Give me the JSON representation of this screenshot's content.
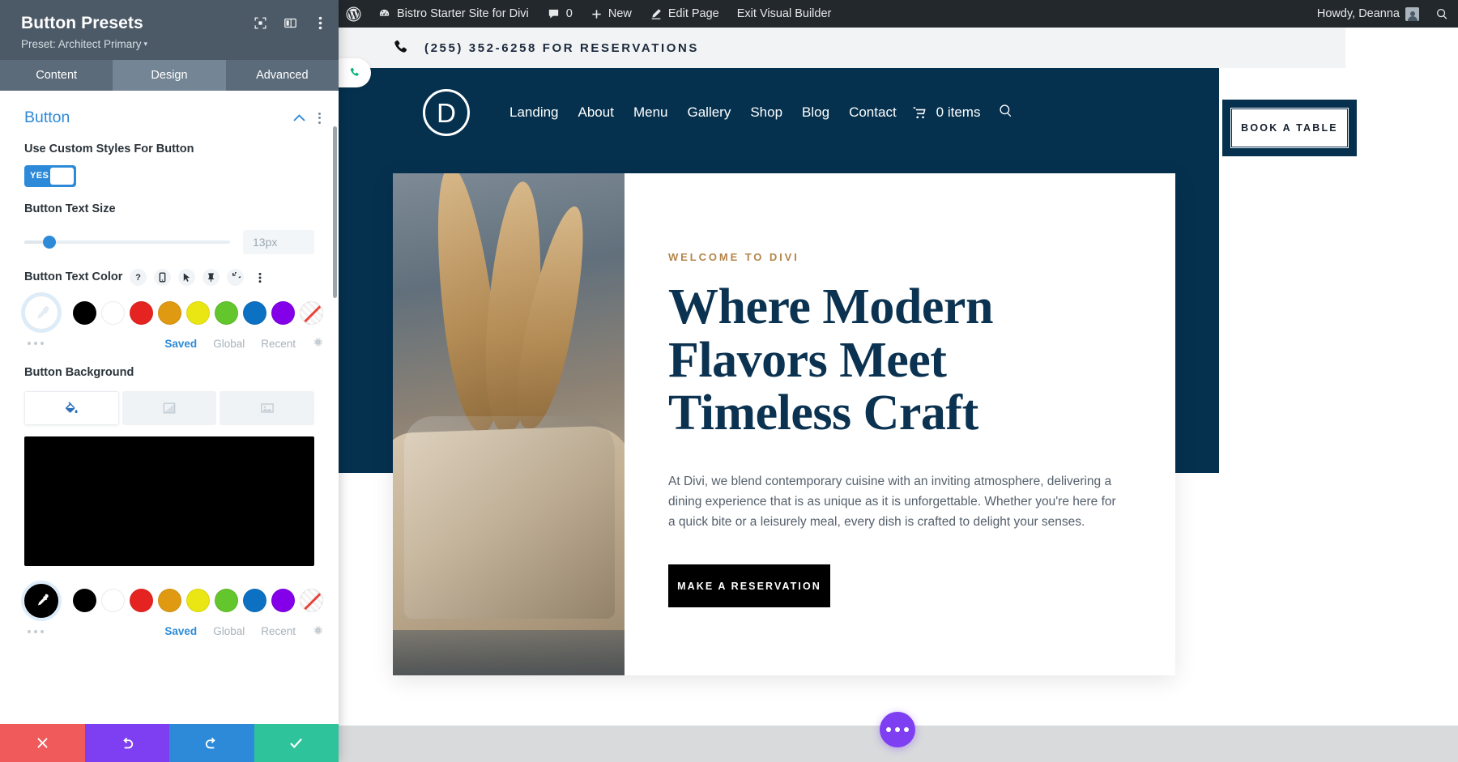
{
  "settings_panel": {
    "title": "Button Presets",
    "preset_label": "Preset: Architect Primary",
    "preset_caret": "▾",
    "header_icons": [
      "focus-target-icon",
      "layout-columns-icon",
      "more-vertical-icon"
    ],
    "tabs": [
      {
        "label": "Content",
        "active": false
      },
      {
        "label": "Design",
        "active": true
      },
      {
        "label": "Advanced",
        "active": false
      }
    ],
    "section": {
      "title": "Button",
      "collapse_icon": "chevron-up-icon",
      "more_icon": "more-vertical-icon"
    },
    "fields": {
      "custom_styles": {
        "label": "Use Custom Styles For Button",
        "toggle_value": "YES"
      },
      "text_size": {
        "label": "Button Text Size",
        "value": "13px",
        "slider_percent": 9
      },
      "text_color": {
        "label": "Button Text Color",
        "control_icons": [
          "help-icon",
          "responsive-icon",
          "hover-icon",
          "sticky-icon",
          "reset-icon",
          "more-vertical-icon"
        ],
        "swatches": [
          "#000000",
          "#ffffff",
          "#e52421",
          "#e09a12",
          "#eae614",
          "#62c62c",
          "#0c71c3",
          "#8300e9",
          "none"
        ],
        "meta_tabs": [
          {
            "label": "Saved",
            "active": true
          },
          {
            "label": "Global",
            "active": false
          },
          {
            "label": "Recent",
            "active": false
          }
        ],
        "gear_icon": "gear-icon",
        "picker_icon": "eyedropper-icon"
      },
      "background": {
        "label": "Button Background",
        "types": [
          {
            "name": "color-fill-icon",
            "active": true
          },
          {
            "name": "gradient-icon",
            "active": false
          },
          {
            "name": "image-icon",
            "active": false
          }
        ],
        "preview_color": "#000000",
        "swatches": [
          "#000000",
          "#ffffff",
          "#e52421",
          "#e09a12",
          "#eae614",
          "#62c62c",
          "#0c71c3",
          "#8300e9",
          "none"
        ],
        "meta_tabs": [
          {
            "label": "Saved",
            "active": true
          },
          {
            "label": "Global",
            "active": false
          },
          {
            "label": "Recent",
            "active": false
          }
        ],
        "gear_icon": "gear-icon",
        "picker_icon": "eyedropper-icon"
      }
    },
    "footer": [
      {
        "name": "cancel-button",
        "icon": "close-icon",
        "color": "#f15a5a"
      },
      {
        "name": "undo-button",
        "icon": "undo-icon",
        "color": "#7e3ff2"
      },
      {
        "name": "redo-button",
        "icon": "redo-icon",
        "color": "#2d8ad8"
      },
      {
        "name": "save-button",
        "icon": "check-icon",
        "color": "#2fc39b"
      }
    ]
  },
  "admin_bar": {
    "wp_logo": "wordpress-icon",
    "site_name": "Bistro Starter Site for Divi",
    "comments_icon": "comment-icon",
    "comments_count": "0",
    "new_icon": "plus-icon",
    "new_label": "New",
    "edit_icon": "pencil-icon",
    "edit_label": "Edit Page",
    "exit_label": "Exit Visual Builder",
    "greeting": "Howdy, Deanna",
    "search_icon": "search-icon"
  },
  "site": {
    "topbar": {
      "phone_icon": "phone-icon",
      "text": "(255) 352-6258 FOR RESERVATIONS"
    },
    "float_tab_icon": "phone-icon",
    "logo_letter": "D",
    "nav_links": [
      "Landing",
      "About",
      "Menu",
      "Gallery",
      "Shop",
      "Blog",
      "Contact"
    ],
    "cart_icon": "cart-icon",
    "cart_label": "0 items",
    "search_icon": "search-icon",
    "book_button": "BOOK A TABLE",
    "hero": {
      "eyebrow": "WELCOME TO DIVI",
      "heading": "Where Modern Flavors Meet Timeless Craft",
      "paragraph": "At Divi, we blend contemporary cuisine with an inviting atmosphere, delivering a dining experience that is as unique as it is unforgettable. Whether you're here for a quick bite or a leisurely meal, every dish is crafted to delight your senses.",
      "cta": "MAKE A RESERVATION",
      "image_alt": "breadsticks-in-paper-bag-photo"
    },
    "fab_icon": "more-horizontal-icon"
  },
  "colors": {
    "panel_header": "#4c5a67",
    "panel_tabbar": "#5b6b7a",
    "accent_blue": "#2d8ad8",
    "navy": "#05314f",
    "gold": "#b5854b",
    "adminbar": "#23282d"
  }
}
